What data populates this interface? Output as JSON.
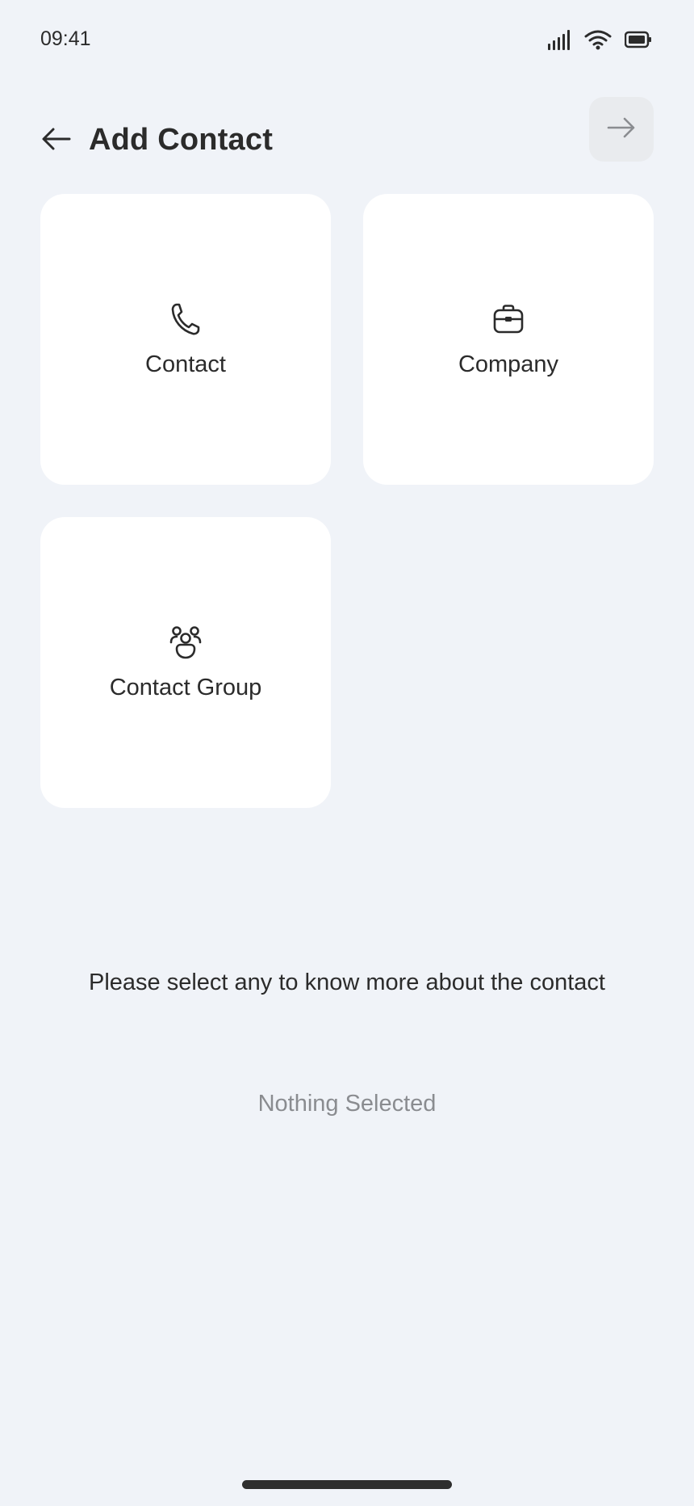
{
  "status_bar": {
    "time": "09:41",
    "icons": [
      "signal-icon",
      "wifi-icon",
      "battery-icon"
    ]
  },
  "header": {
    "title": "Add Contact",
    "back_icon": "arrow-left-icon",
    "next_icon": "arrow-right-icon"
  },
  "options": [
    {
      "label": "Contact",
      "icon": "phone-icon"
    },
    {
      "label": "Company",
      "icon": "briefcase-icon"
    },
    {
      "label": "Contact Group",
      "icon": "group-icon"
    }
  ],
  "prompt": "Please select any to know more about the contact",
  "selection_status": "Nothing Selected",
  "colors": {
    "background": "#F0F3F8",
    "card": "#FFFFFF",
    "text": "#2B2B2B",
    "muted_text": "#8A8C90",
    "next_button_bg": "#E9EBEE"
  }
}
